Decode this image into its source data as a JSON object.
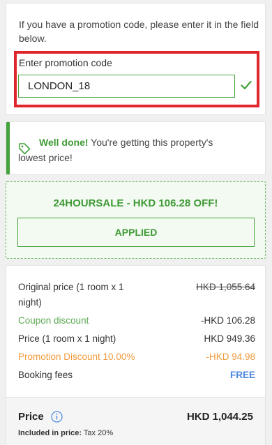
{
  "promo": {
    "intro": "If you have a promotion code, please enter it in the field below.",
    "field_label": "Enter promotion code",
    "code_value": "LONDON_18",
    "check_icon": "checkmark-icon",
    "highlight_color": "#e0262d"
  },
  "notice": {
    "bold": "Well done!",
    "text_line1": " You're getting this property's",
    "text_line2": "lowest price!",
    "icon": "tag-icon"
  },
  "coupon": {
    "title": "24HOURSALE - HKD 106.28 OFF!",
    "button_label": "APPLIED"
  },
  "price": {
    "rows": [
      {
        "label": "Original price (1 room x 1",
        "label2": "night)",
        "value": "HKD 1,055.64"
      },
      {
        "label": "Coupon discount",
        "value": "-HKD 106.28"
      },
      {
        "label": "Price (1 room x 1 night)",
        "value": "HKD 949.36"
      },
      {
        "label": "Promotion Discount 10.00%",
        "value": "-HKD 94.98"
      },
      {
        "label": "Booking fees",
        "value": "FREE"
      }
    ],
    "total_label": "Price",
    "total_value": "HKD 1,044.25",
    "included_label": "Included in price:",
    "included_value": " Tax 20%",
    "info_icon": "info-icon"
  },
  "colors": {
    "green": "#45a33c",
    "orange": "#f09a3a",
    "blue": "#4a86e0"
  }
}
